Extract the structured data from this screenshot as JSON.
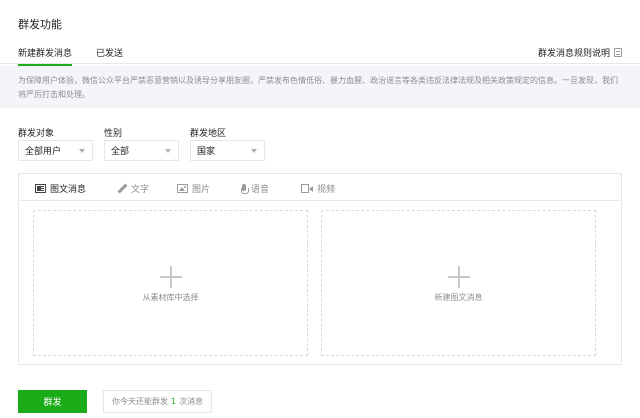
{
  "page": {
    "title": "群发功能"
  },
  "tabs": [
    {
      "label": "新建群发消息",
      "active": true
    },
    {
      "label": "已发送",
      "active": false
    }
  ],
  "rules_link": {
    "label": "群发消息规则说明",
    "icon": "document-icon"
  },
  "notice": {
    "text": "为保障用户体验，微信公众平台严禁恶意营销以及诱导分享朋友圈，严禁发布色情低俗、暴力血腥、政治谣言等各类违反法律法规及相关政策规定的信息。一旦发现，我们将严厉打击和处理。"
  },
  "filters": [
    {
      "label": "群发对象",
      "value": "全部用户"
    },
    {
      "label": "性别",
      "value": "全部"
    },
    {
      "label": "群发地区",
      "value": "国家"
    }
  ],
  "message_types": [
    {
      "label": "图文消息",
      "icon": "news-icon",
      "active": true
    },
    {
      "label": "文字",
      "icon": "pen-icon",
      "active": false
    },
    {
      "label": "图片",
      "icon": "image-icon",
      "active": false
    },
    {
      "label": "语音",
      "icon": "microphone-icon",
      "active": false
    },
    {
      "label": "视频",
      "icon": "video-icon",
      "active": false
    }
  ],
  "slots": [
    {
      "label": "从素材库中选择"
    },
    {
      "label": "新建图文消息"
    }
  ],
  "send_button": {
    "label": "群发"
  },
  "quota": {
    "prefix": "你今天还能群发",
    "count": "1",
    "suffix": "次消息"
  },
  "colors": {
    "accent": "#1aad19",
    "notice_bg": "#f4f5f9",
    "border": "#e7e7eb"
  }
}
